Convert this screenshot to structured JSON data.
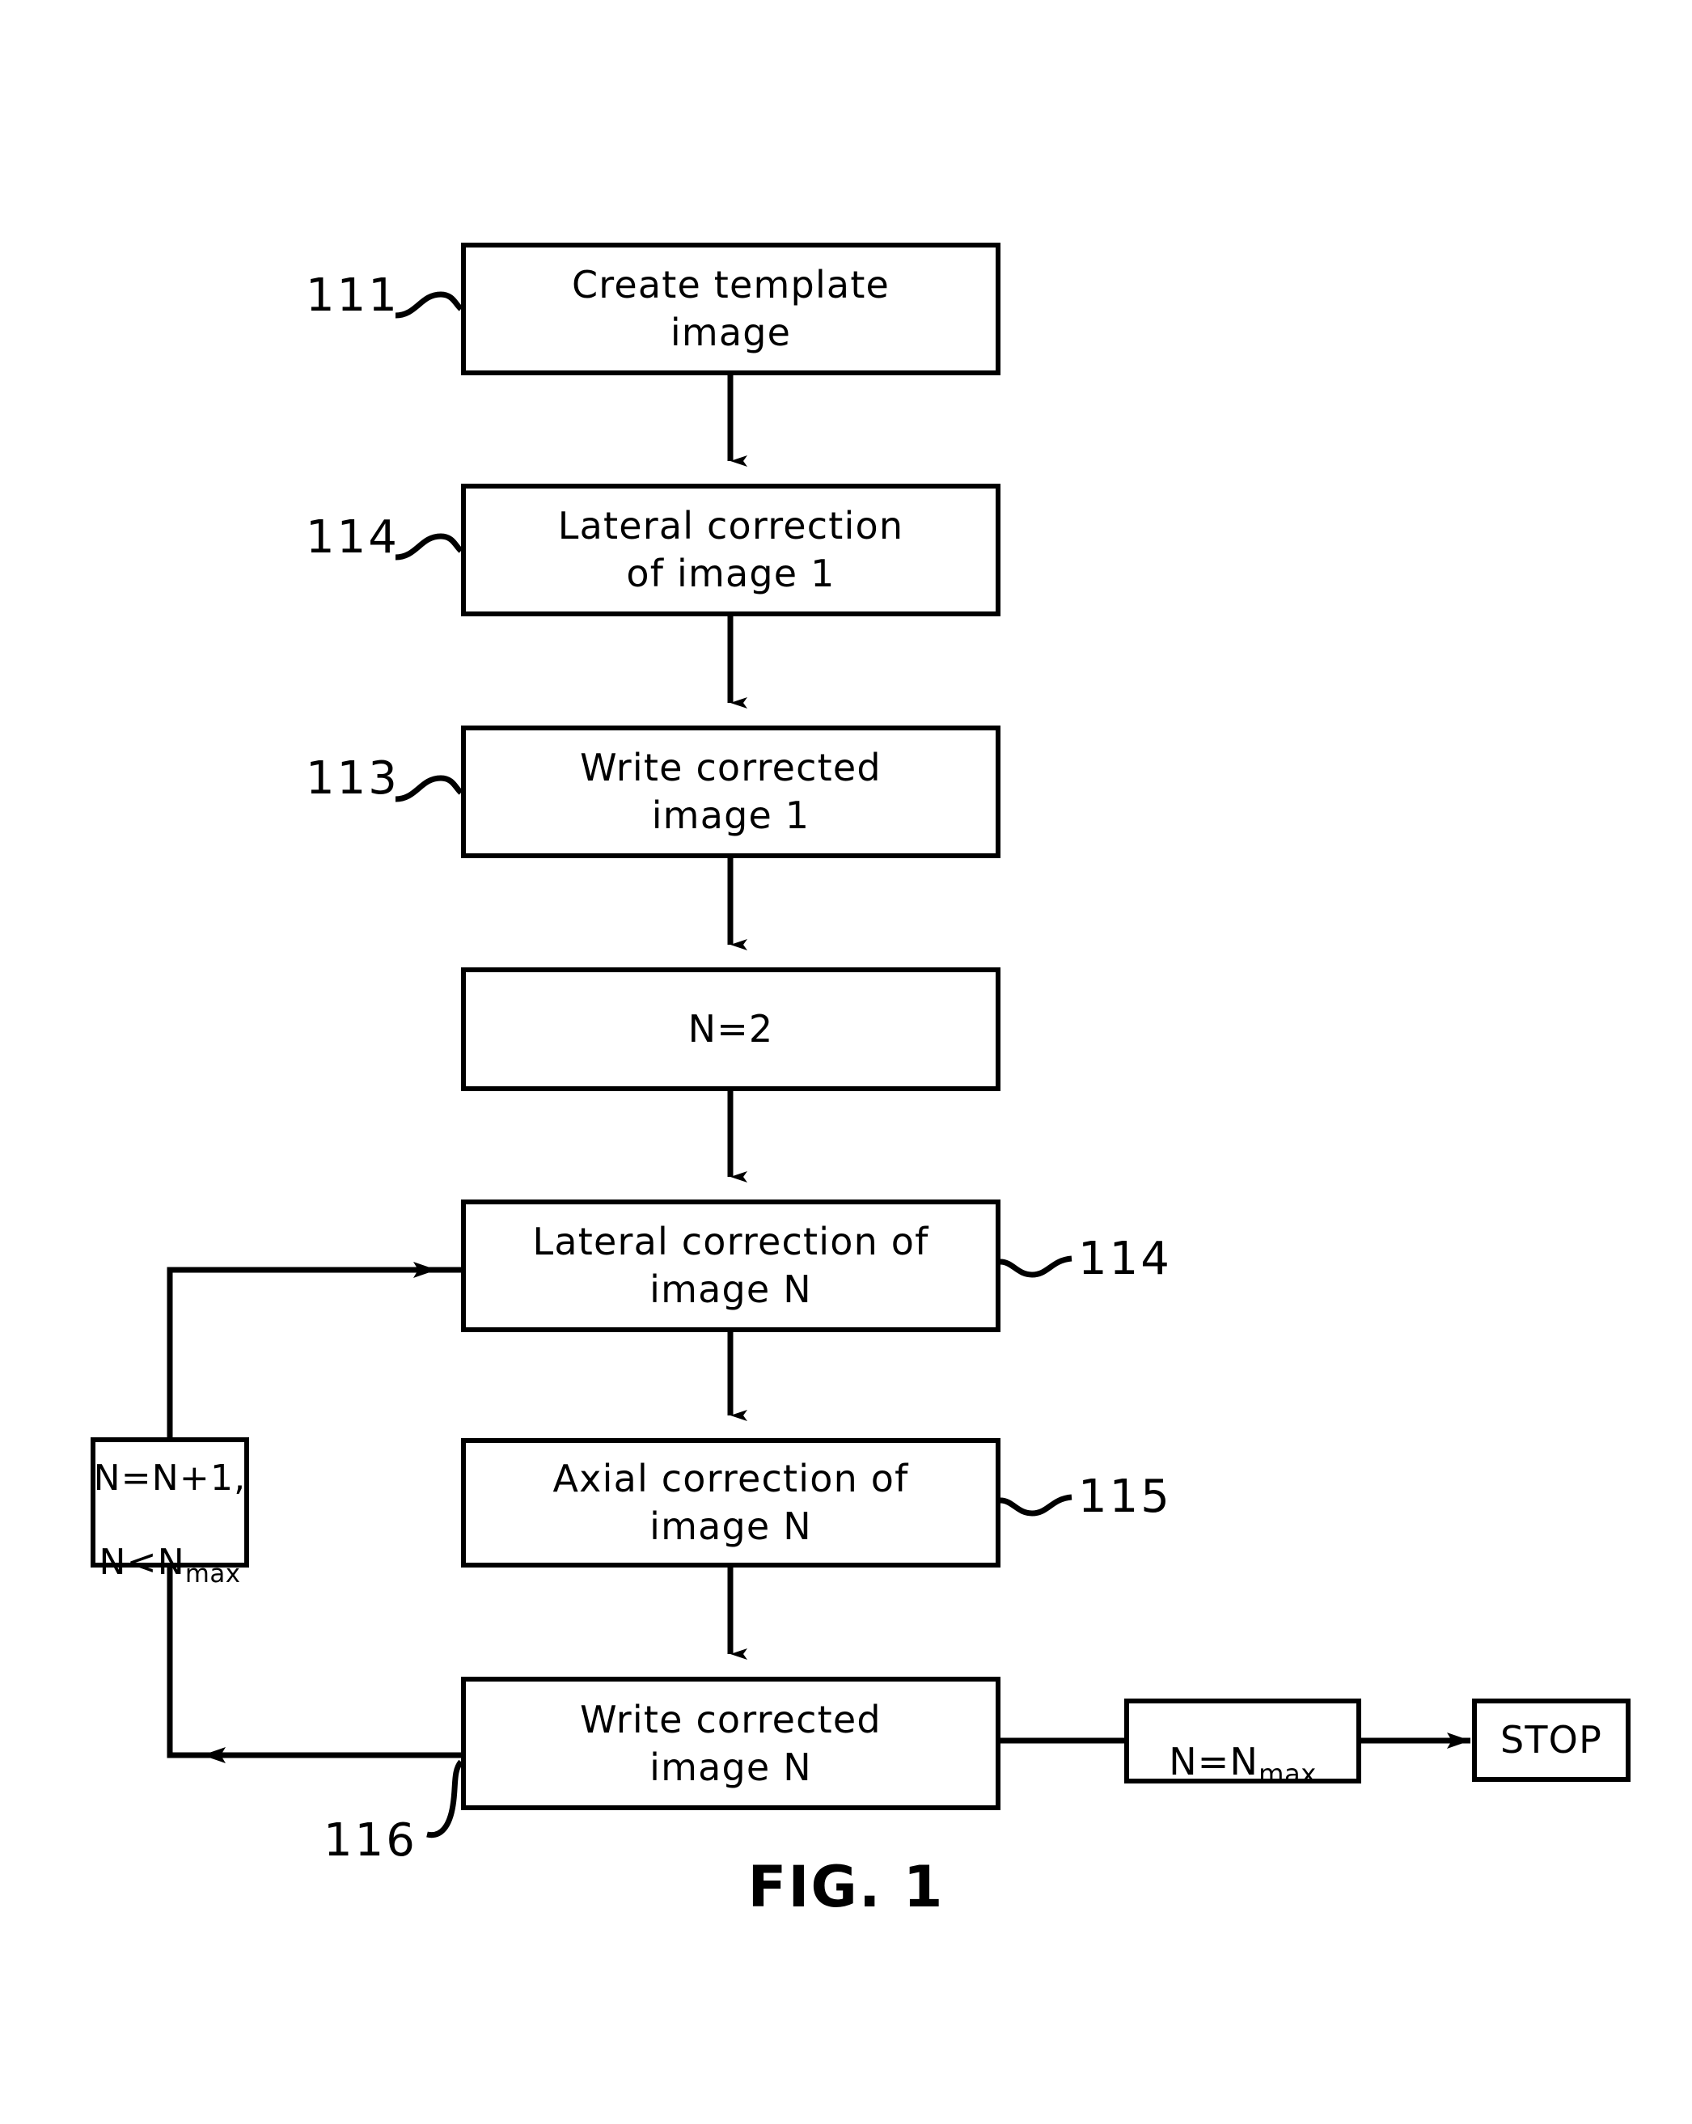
{
  "figure": {
    "caption": "FIG. 1",
    "type": "flowchart",
    "ink_color": "#000000",
    "background_color": "#ffffff"
  },
  "nodes": {
    "create_template": {
      "label": "Create  template\nimage",
      "ref": "111"
    },
    "lateral_1": {
      "label": "Lateral  correction\nof  image  1",
      "ref": "114"
    },
    "write_1": {
      "label": "Write  corrected\nimage  1",
      "ref": "113"
    },
    "n_equals_2": {
      "label": "N=2",
      "ref": ""
    },
    "lateral_n": {
      "label": "Lateral  correction  of\nimage  N",
      "ref": "114"
    },
    "axial_n": {
      "label": "Axial  correction  of\nimage  N",
      "ref": "115"
    },
    "write_n": {
      "label": "Write  corrected\nimage  N",
      "ref": "116"
    },
    "increment": {
      "line1": "N=N+1,",
      "line2_main": "N<N",
      "line2_sub": "max",
      "ref": ""
    },
    "n_equals_nmax": {
      "main": "N=N",
      "sub": "max",
      "ref": ""
    },
    "stop": {
      "label": "STOP",
      "ref": ""
    }
  },
  "callouts": {
    "ref_111": "111",
    "ref_114_top": "114",
    "ref_113": "113",
    "ref_114_loop": "114",
    "ref_115": "115",
    "ref_116": "116"
  },
  "edges": [
    {
      "from": "create_template",
      "to": "lateral_1",
      "direction": "down",
      "arrowhead": true
    },
    {
      "from": "lateral_1",
      "to": "write_1",
      "direction": "down",
      "arrowhead": true
    },
    {
      "from": "write_1",
      "to": "n_equals_2",
      "direction": "down",
      "arrowhead": true
    },
    {
      "from": "n_equals_2",
      "to": "lateral_n",
      "direction": "down",
      "arrowhead": true
    },
    {
      "from": "lateral_n",
      "to": "axial_n",
      "direction": "down",
      "arrowhead": true
    },
    {
      "from": "axial_n",
      "to": "write_n",
      "direction": "down",
      "arrowhead": true
    },
    {
      "from": "write_n",
      "to": "increment",
      "direction": "left-up-loop",
      "arrowhead": true
    },
    {
      "from": "increment",
      "to": "lateral_n",
      "direction": "up-right-loop",
      "arrowhead": true
    },
    {
      "from": "write_n",
      "to": "n_equals_nmax",
      "direction": "right",
      "arrowhead": false
    },
    {
      "from": "n_equals_nmax",
      "to": "stop",
      "direction": "right",
      "arrowhead": true
    }
  ]
}
